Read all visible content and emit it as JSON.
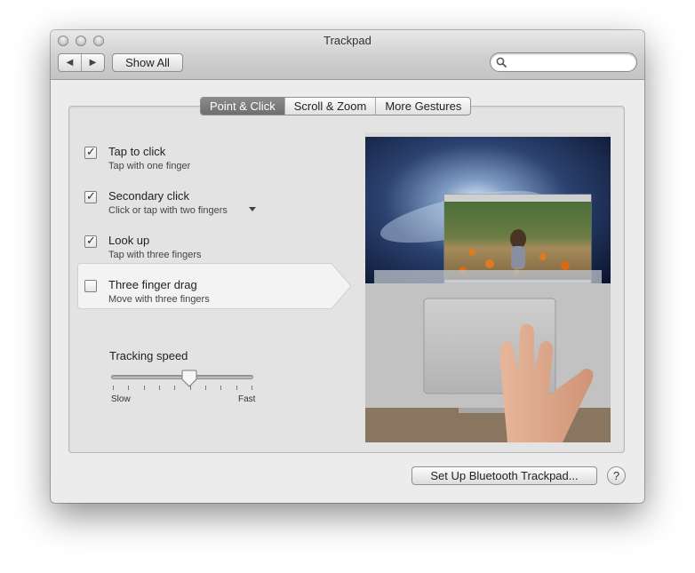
{
  "window": {
    "title": "Trackpad"
  },
  "toolbar": {
    "back_icon": "◀",
    "forward_icon": "▶",
    "show_all_label": "Show All",
    "search_value": "",
    "search_placeholder": ""
  },
  "tabs": [
    {
      "label": "Point & Click",
      "active": true
    },
    {
      "label": "Scroll & Zoom",
      "active": false
    },
    {
      "label": "More Gestures",
      "active": false
    }
  ],
  "options": [
    {
      "title": "Tap to click",
      "subtitle": "Tap with one finger",
      "checked": true
    },
    {
      "title": "Secondary click",
      "subtitle": "Click or tap with two fingers",
      "checked": true,
      "has_dropdown": true
    },
    {
      "title": "Look up",
      "subtitle": "Tap with three fingers",
      "checked": true
    },
    {
      "title": "Three finger drag",
      "subtitle": "Move with three fingers",
      "checked": false,
      "selected": true
    }
  ],
  "tracking_speed": {
    "label": "Tracking speed",
    "min_label": "Slow",
    "max_label": "Fast",
    "level": 0.55,
    "ticks": 10
  },
  "footer": {
    "bluetooth_button_label": "Set Up Bluetooth Trackpad...",
    "help_label": "?"
  },
  "colors": {
    "active_tab": "#777777",
    "window_background": "#ececec",
    "panel_background": "#e3e3e3"
  }
}
